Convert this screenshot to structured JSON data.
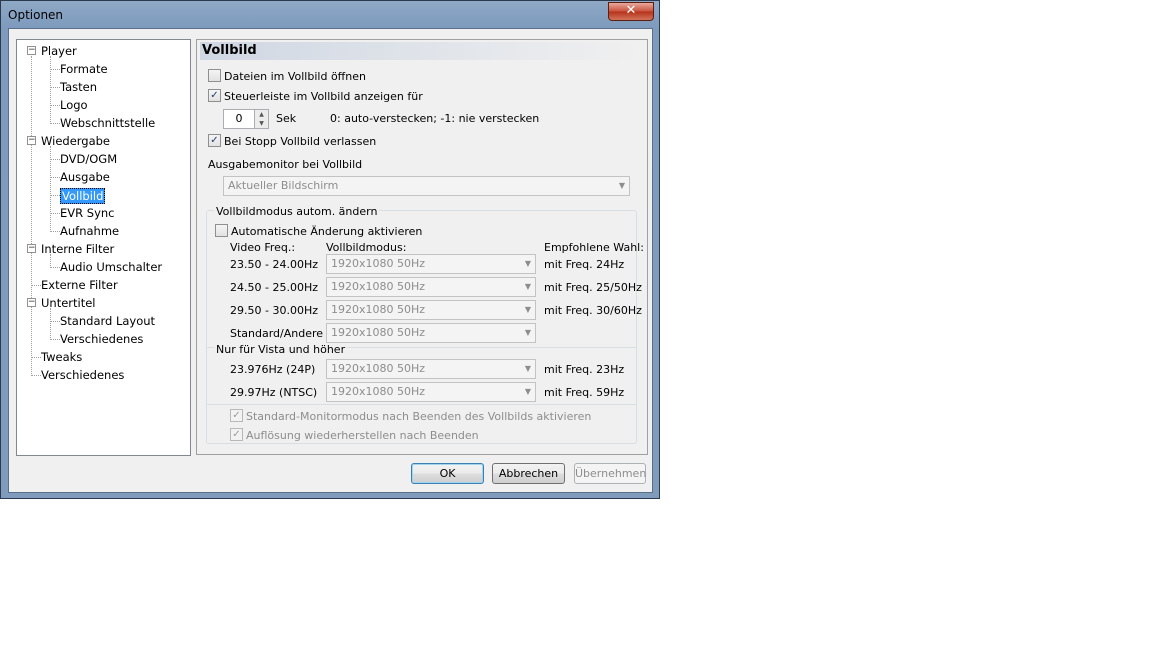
{
  "window": {
    "title": "Optionen",
    "close_glyph": "✕"
  },
  "tree": {
    "items": [
      {
        "label": "Player",
        "level": 0,
        "expander": "−"
      },
      {
        "label": "Formate",
        "level": 1
      },
      {
        "label": "Tasten",
        "level": 1
      },
      {
        "label": "Logo",
        "level": 1
      },
      {
        "label": "Webschnittstelle",
        "level": 1
      },
      {
        "label": "Wiedergabe",
        "level": 0,
        "expander": "−"
      },
      {
        "label": "DVD/OGM",
        "level": 1
      },
      {
        "label": "Ausgabe",
        "level": 1
      },
      {
        "label": "Vollbild",
        "level": 1,
        "selected": true
      },
      {
        "label": "EVR Sync",
        "level": 1
      },
      {
        "label": "Aufnahme",
        "level": 1
      },
      {
        "label": "Interne Filter",
        "level": 0,
        "expander": "−"
      },
      {
        "label": "Audio Umschalter",
        "level": 1
      },
      {
        "label": "Externe Filter",
        "level": 0
      },
      {
        "label": "Untertitel",
        "level": 0,
        "expander": "−"
      },
      {
        "label": "Standard Layout",
        "level": 1
      },
      {
        "label": "Verschiedenes",
        "level": 1
      },
      {
        "label": "Tweaks",
        "level": 0
      },
      {
        "label": "Verschiedenes",
        "level": 0
      }
    ]
  },
  "panel": {
    "title": "Vollbild",
    "open_fullscreen": {
      "label": "Dateien im Vollbild öffnen",
      "checked": false
    },
    "show_toolbar": {
      "label": "Steuerleiste im Vollbild anzeigen für",
      "checked": true
    },
    "seconds": {
      "value": "0",
      "unit": "Sek",
      "hint": "0: auto-verstecken; -1: nie verstecken"
    },
    "exit_on_stop": {
      "label": "Bei Stopp Vollbild verlassen",
      "checked": true
    },
    "monitor_label": "Ausgabemonitor bei Vollbild",
    "monitor_value": "Aktueller Bildschirm",
    "auto_group": {
      "title": "Vollbildmodus autom. ändern",
      "auto_change": {
        "label": "Automatische Änderung aktivieren",
        "checked": false
      },
      "col_freq": "Video Freq.:",
      "col_mode": "Vollbildmodus:",
      "col_rec": "Empfohlene Wahl:",
      "rows": [
        {
          "freq": "23.50 - 24.00Hz",
          "mode": "1920x1080 50Hz",
          "rec": "mit Freq. 24Hz"
        },
        {
          "freq": "24.50 - 25.00Hz",
          "mode": "1920x1080 50Hz",
          "rec": "mit Freq. 25/50Hz"
        },
        {
          "freq": "29.50 - 30.00Hz",
          "mode": "1920x1080 50Hz",
          "rec": "mit Freq. 30/60Hz"
        },
        {
          "freq": "Standard/Andere",
          "mode": "1920x1080 50Hz",
          "rec": ""
        }
      ],
      "vista_title": "Nur für Vista und höher",
      "vista_rows": [
        {
          "freq": "23.976Hz (24P)",
          "mode": "1920x1080 50Hz",
          "rec": "mit Freq. 23Hz"
        },
        {
          "freq": "29.97Hz (NTSC)",
          "mode": "1920x1080 50Hz",
          "rec": "mit Freq. 59Hz"
        }
      ],
      "restore_monitor": {
        "label": "Standard-Monitormodus nach Beenden des Vollbilds aktivieren",
        "checked": true
      },
      "restore_res": {
        "label": "Auflösung wiederherstellen nach Beenden",
        "checked": true
      }
    }
  },
  "buttons": {
    "ok": "OK",
    "cancel": "Abbrechen",
    "apply": "Übernehmen"
  },
  "icons": {
    "check": "✓",
    "arrow_down": "▼",
    "spin_up": "▲",
    "spin_down": "▼"
  }
}
